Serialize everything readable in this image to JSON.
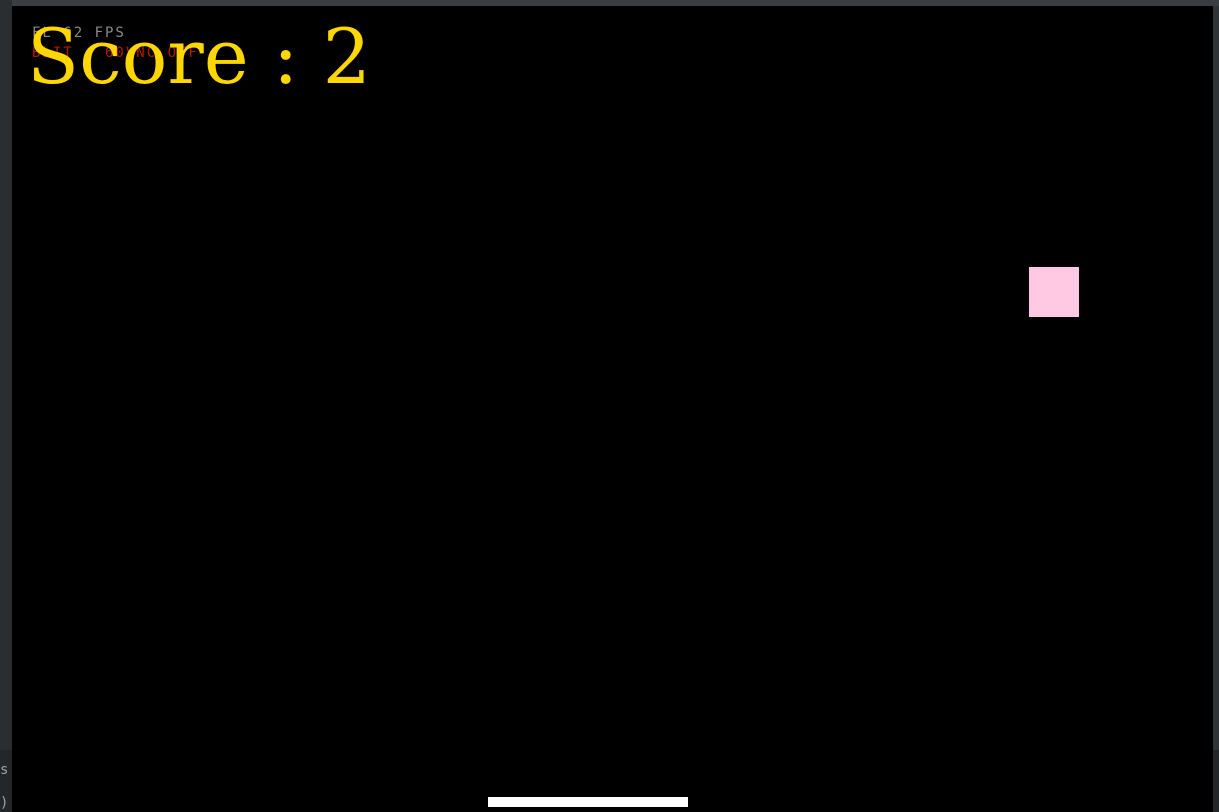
{
  "game": {
    "fps_readout": "FL 62 FPS",
    "blit_readout": "BLIT - 60VNC OFF",
    "score_label": "Score : 2",
    "score": 2
  },
  "terminal": {
    "left_fragment_top": "s",
    "left_fragment_bottom": ")"
  },
  "colors": {
    "background": "#000000",
    "score": "#ffd700",
    "enemy_block": "#ffc8e3",
    "paddle": "#ffffff"
  },
  "icons": {
    "enemy_block": "pink-square",
    "player": "paddle"
  }
}
